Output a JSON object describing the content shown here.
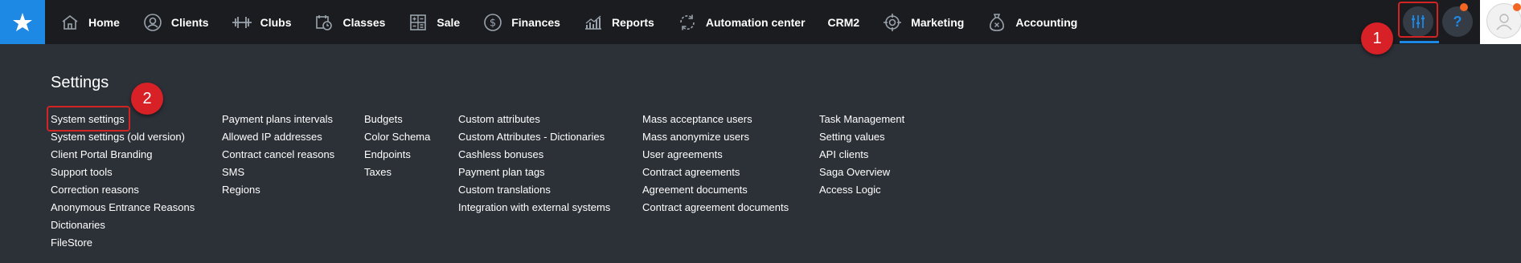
{
  "nav": {
    "items": [
      {
        "label": "Home",
        "icon": "home-icon"
      },
      {
        "label": "Clients",
        "icon": "clients-icon"
      },
      {
        "label": "Clubs",
        "icon": "dumbbell-icon"
      },
      {
        "label": "Classes",
        "icon": "calendar-clock-icon"
      },
      {
        "label": "Sale",
        "icon": "calculator-icon"
      },
      {
        "label": "Finances",
        "icon": "dollar-coin-icon"
      },
      {
        "label": "Reports",
        "icon": "chart-icon"
      },
      {
        "label": "Automation center",
        "icon": "sync-icon"
      },
      {
        "label": "CRM2",
        "icon": ""
      },
      {
        "label": "Marketing",
        "icon": "target-icon"
      },
      {
        "label": "Accounting",
        "icon": "money-bag-icon"
      }
    ]
  },
  "toolbar": {
    "help_label": "?",
    "settings_icon": "sliders-icon"
  },
  "callouts": {
    "one": "1",
    "two": "2"
  },
  "settings": {
    "title": "Settings",
    "columns": [
      [
        "System settings",
        "System settings (old version)",
        "Client Portal Branding",
        "Support tools",
        "Correction reasons",
        "Anonymous Entrance Reasons",
        "Dictionaries",
        "FileStore"
      ],
      [
        "Payment plans intervals",
        "Allowed IP addresses",
        "Contract cancel reasons",
        "SMS",
        "Regions"
      ],
      [
        "Budgets",
        "Color Schema",
        "Endpoints",
        "Taxes"
      ],
      [
        "Custom attributes",
        "Custom Attributes - Dictionaries",
        "Cashless bonuses",
        "Payment plan tags",
        "Custom translations",
        "Integration with external systems"
      ],
      [
        "Mass acceptance users",
        "Mass anonymize users",
        "User agreements",
        "Contract agreements",
        "Agreement documents",
        "Contract agreement documents"
      ],
      [
        "Task Management",
        "Setting values",
        "API clients",
        "Saga Overview",
        "Access Logic"
      ]
    ]
  },
  "colors": {
    "accent": "#1e88e5",
    "topbar_bg": "#1a1c1f",
    "panel_bg": "#2c3037",
    "callout_red": "#d82027",
    "notification_orange": "#f26522"
  }
}
